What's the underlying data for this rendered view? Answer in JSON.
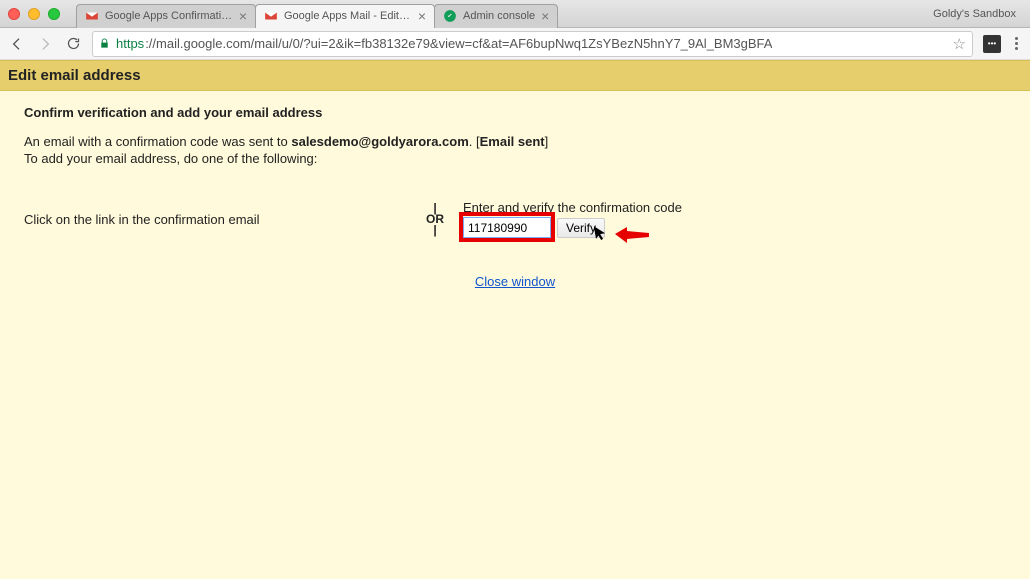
{
  "browser": {
    "profile": "Goldy's Sandbox",
    "tabs": [
      {
        "label": "Google Apps Confirmation - Se",
        "favicon": "gmail",
        "active": false
      },
      {
        "label": "Google Apps Mail - Edit email",
        "favicon": "gmail",
        "active": true
      },
      {
        "label": "Admin console",
        "favicon": "admin",
        "active": false
      }
    ],
    "url_scheme": "https",
    "url_rest": "://mail.google.com/mail/u/0/?ui=2&ik=fb38132e79&view=cf&at=AF6bupNwq1ZsYBezN5hnY7_9Al_BM3gBFA"
  },
  "page": {
    "title": "Edit email address",
    "subheading": "Confirm verification and add your email address",
    "line1_prefix": "An email with a confirmation code was sent to ",
    "email": "salesdemo@goldyarora.com",
    "line1_suffix": ". [",
    "email_sent": "Email sent",
    "line1_end": "]",
    "line2": "To add your email address, do one of the following:",
    "option_left": "Click on the link in the confirmation email",
    "or": "OR",
    "option_right": "Enter and verify the confirmation code",
    "code_value": "117180990",
    "verify": "Verify",
    "close": "Close window"
  }
}
